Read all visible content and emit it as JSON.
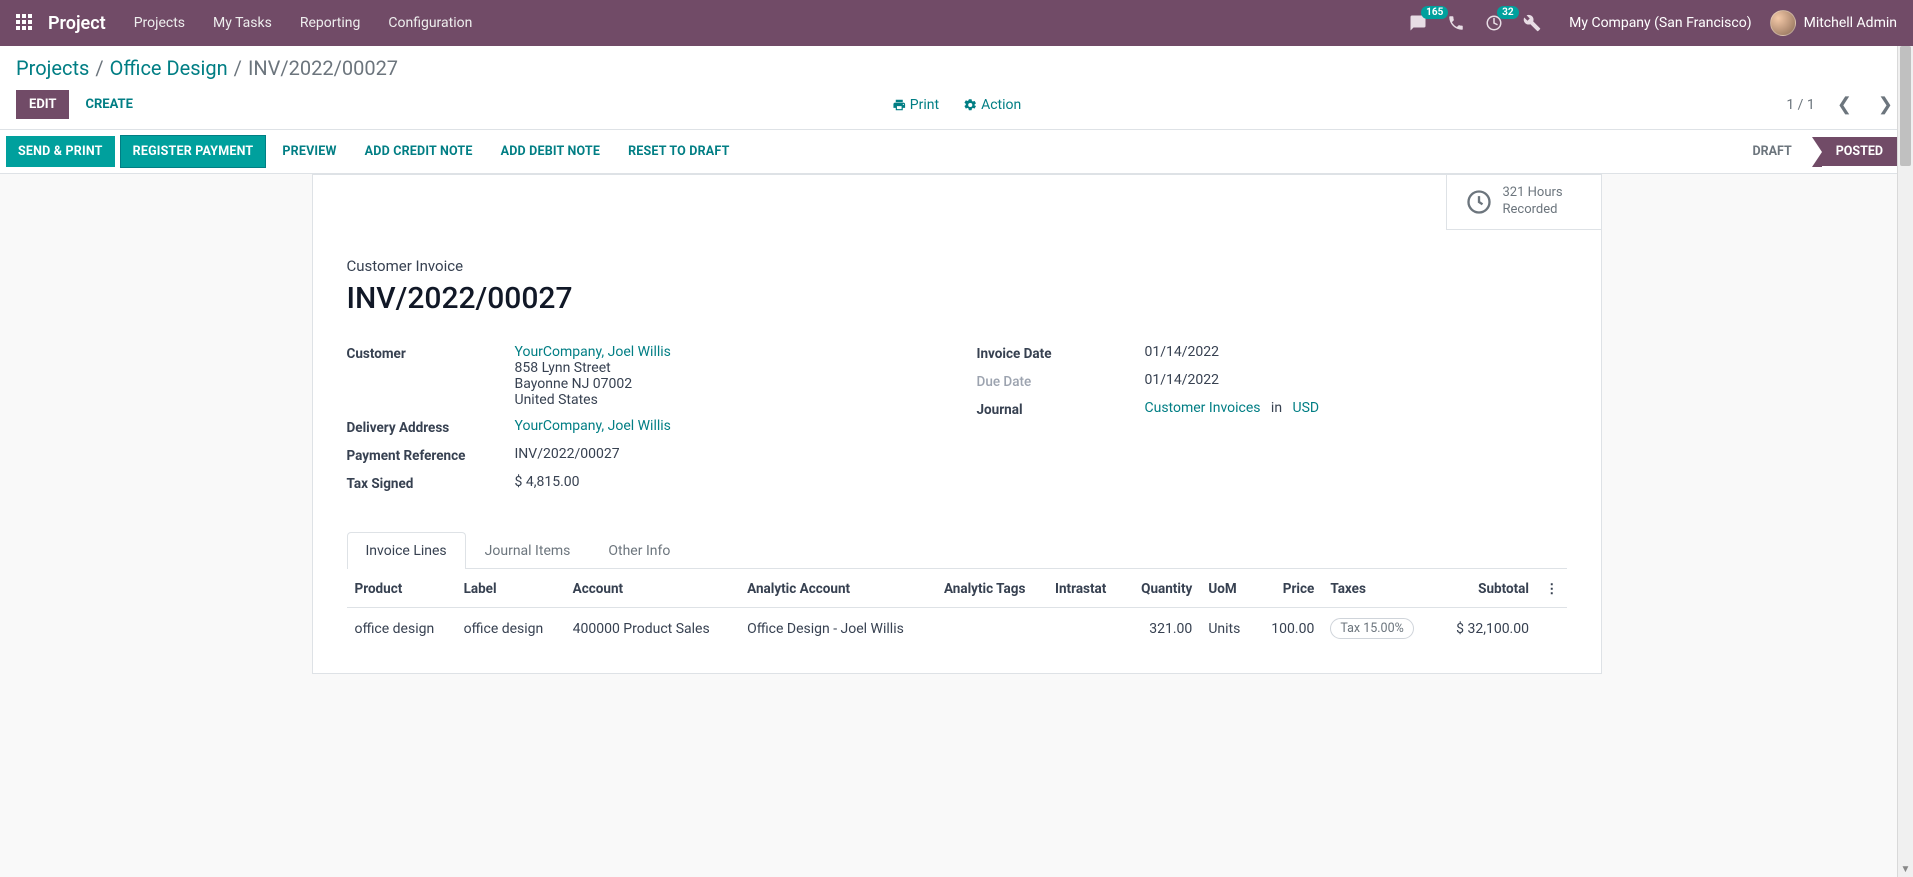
{
  "navbar": {
    "brand": "Project",
    "items": [
      "Projects",
      "My Tasks",
      "Reporting",
      "Configuration"
    ],
    "messages_badge": "165",
    "activities_badge": "32",
    "company": "My Company (San Francisco)",
    "user": "Mitchell Admin"
  },
  "breadcrumb": {
    "projects": "Projects",
    "office": "Office Design",
    "current": "INV/2022/00027"
  },
  "control": {
    "edit": "Edit",
    "create": "Create",
    "print": "Print",
    "action": "Action",
    "pager": "1 / 1"
  },
  "statusbar": {
    "send_print": "Send & Print",
    "register_payment": "Register Payment",
    "preview": "Preview",
    "add_credit_note": "Add Credit Note",
    "add_debit_note": "Add Debit Note",
    "reset_to_draft": "Reset to Draft",
    "draft": "Draft",
    "posted": "Posted"
  },
  "stat_button": {
    "line1": "321 Hours",
    "line2": "Recorded"
  },
  "sheet": {
    "doc_type": "Customer Invoice",
    "doc_title": "INV/2022/00027",
    "labels": {
      "customer": "Customer",
      "delivery_address": "Delivery Address",
      "payment_reference": "Payment Reference",
      "tax_signed": "Tax Signed",
      "invoice_date": "Invoice Date",
      "due_date": "Due Date",
      "journal": "Journal"
    },
    "customer_link": "YourCompany, Joel Willis",
    "address1": "858 Lynn Street",
    "address2": "Bayonne NJ 07002",
    "address3": "United States",
    "delivery_link": "YourCompany, Joel Willis",
    "payment_reference": "INV/2022/00027",
    "tax_signed": "$ 4,815.00",
    "invoice_date": "01/14/2022",
    "due_date": "01/14/2022",
    "journal_link": "Customer Invoices",
    "journal_in": "in",
    "journal_currency": "USD"
  },
  "tabs": {
    "invoice_lines": "Invoice Lines",
    "journal_items": "Journal Items",
    "other_info": "Other Info"
  },
  "table": {
    "headers": {
      "product": "Product",
      "label": "Label",
      "account": "Account",
      "analytic_account": "Analytic Account",
      "analytic_tags": "Analytic Tags",
      "intrastat": "Intrastat",
      "quantity": "Quantity",
      "uom": "UoM",
      "price": "Price",
      "taxes": "Taxes",
      "subtotal": "Subtotal"
    },
    "row": {
      "product": "office design",
      "label": "office design",
      "account": "400000 Product Sales",
      "analytic_account": "Office Design - Joel Willis",
      "analytic_tags": "",
      "intrastat": "",
      "quantity": "321.00",
      "uom": "Units",
      "price": "100.00",
      "taxes": "Tax 15.00%",
      "subtotal": "$ 32,100.00"
    }
  }
}
